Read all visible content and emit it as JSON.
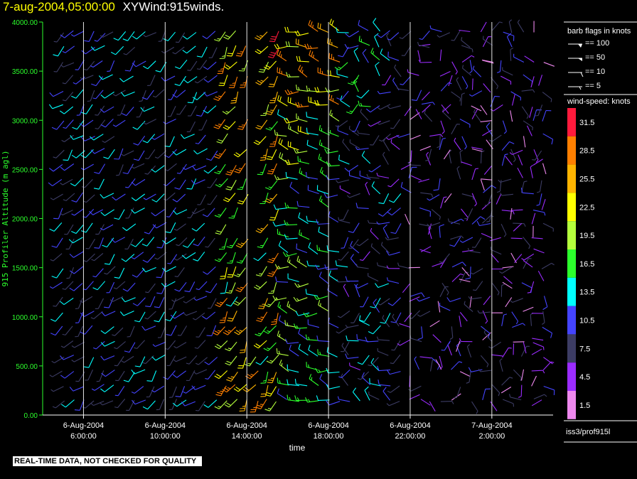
{
  "header": {
    "timestamp": "7-aug-2004,05:00:00",
    "product": "XYWind:915winds."
  },
  "footer": {
    "notice": "REAL-TIME DATA, NOT CHECKED FOR QUALITY",
    "source": "iss3/prof915l"
  },
  "legend": {
    "barb_title": "barb flags in knots",
    "barbs": [
      "== 100",
      "== 50",
      "== 10",
      "== 5"
    ],
    "speed_title": "wind-speed: knots",
    "speed_bins": [
      {
        "label": "31.5",
        "color": "#ff1a3c"
      },
      {
        "label": "28.5",
        "color": "#ff7f00"
      },
      {
        "label": "25.5",
        "color": "#ffb400"
      },
      {
        "label": "22.5",
        "color": "#ffff00"
      },
      {
        "label": "19.5",
        "color": "#b4ff3c"
      },
      {
        "label": "16.5",
        "color": "#2cff2c"
      },
      {
        "label": "13.5",
        "color": "#00ffff"
      },
      {
        "label": "10.5",
        "color": "#4444ff"
      },
      {
        "label": "7.5",
        "color": "#3c3c64"
      },
      {
        "label": "4.5",
        "color": "#9b2cff"
      },
      {
        "label": "1.5",
        "color": "#ee88ee"
      }
    ]
  },
  "chart_data": {
    "type": "scatter",
    "subtype": "wind-barb time-height",
    "xlabel": "time",
    "ylabel": "915 Profiler Altitude (m agl)",
    "xlim": [
      "2004-08-06 04:00",
      "2004-08-07 05:00"
    ],
    "ylim": [
      0,
      4000
    ],
    "yticks": [
      "0.00",
      "500.00",
      "1000.00",
      "1500.00",
      "2000.00",
      "2500.00",
      "3000.00",
      "3500.00",
      "4000.00"
    ],
    "xticks": [
      {
        "date": "6-Aug-2004",
        "time": "6:00:00",
        "t": 2
      },
      {
        "date": "6-Aug-2004",
        "time": "10:00:00",
        "t": 6
      },
      {
        "date": "6-Aug-2004",
        "time": "14:00:00",
        "t": 10
      },
      {
        "date": "6-Aug-2004",
        "time": "18:00:00",
        "t": 14
      },
      {
        "date": "6-Aug-2004",
        "time": "22:00:00",
        "t": 18
      },
      {
        "date": "7-Aug-2004",
        "time": "2:00:00",
        "t": 22
      }
    ],
    "grid": "vertical lines at x ticks",
    "wind_speed_units": "knots",
    "time_columns_hours": [
      1,
      1.5,
      2,
      2.5,
      3,
      3.5,
      4,
      4.5,
      5,
      5.5,
      6,
      6.5,
      7,
      7.5,
      8,
      8.5,
      9,
      9.5,
      10,
      10.5,
      11,
      11.5,
      12,
      12.5,
      13,
      13.5,
      14,
      14.5,
      15,
      15.5,
      16,
      16.5,
      17,
      17.5,
      18,
      18.5,
      19,
      19.5,
      20,
      20.5,
      21,
      21.5,
      22,
      22.5,
      23,
      23.5,
      24,
      24.5
    ],
    "height_levels_m": [
      150,
      300,
      450,
      600,
      750,
      900,
      1050,
      1200,
      1350,
      1500,
      1650,
      1800,
      1950,
      2100,
      2250,
      2400,
      2550,
      2700,
      2850,
      3000,
      3150,
      3300,
      3450,
      3600,
      3750,
      3900
    ]
  }
}
